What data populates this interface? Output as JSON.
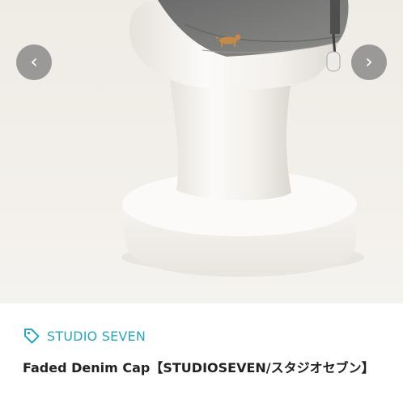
{
  "product_gallery": {
    "prev_icon": "chevron-left-icon",
    "prev_glyph": "‹",
    "next_icon": "chevron-right-icon",
    "next_glyph": "›"
  },
  "brand": {
    "icon": "tag-icon",
    "name": "STUDIO SEVEN",
    "color": "#2aa6c0"
  },
  "product": {
    "title": "Faded Denim Cap【STUDIOSEVEN/スタジオセブン】"
  }
}
